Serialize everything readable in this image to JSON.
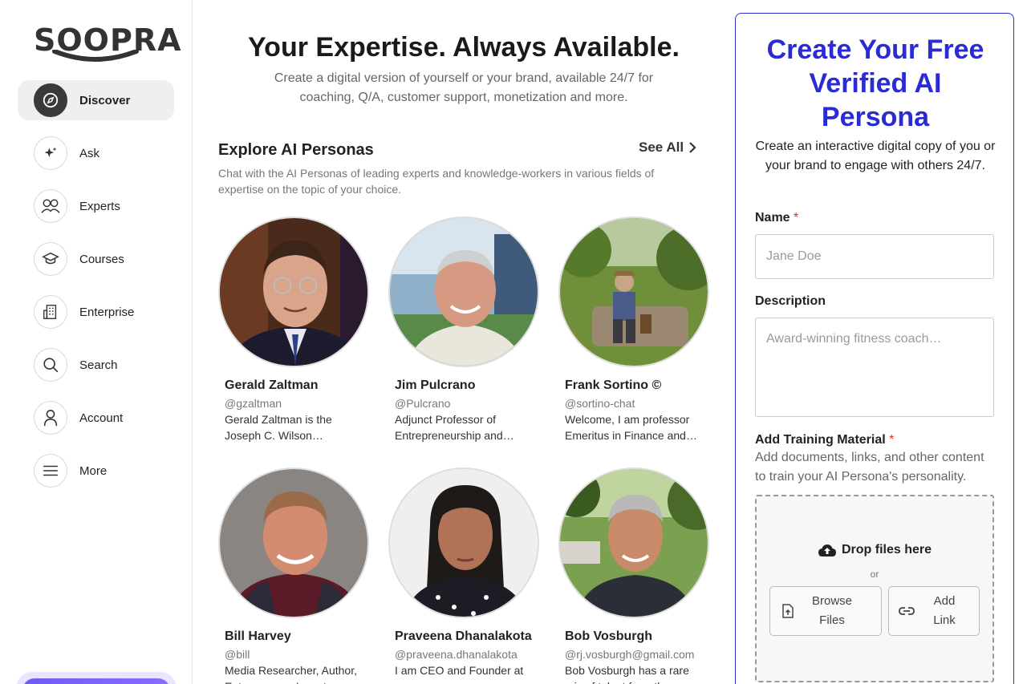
{
  "brand": {
    "name": "SOOPRA"
  },
  "sidebar": {
    "items": [
      {
        "label": "Discover",
        "icon": "compass-icon",
        "active": true
      },
      {
        "label": "Ask",
        "icon": "sparkle-icon"
      },
      {
        "label": "Experts",
        "icon": "people-icon"
      },
      {
        "label": "Courses",
        "icon": "graduation-cap-icon"
      },
      {
        "label": "Enterprise",
        "icon": "building-icon"
      },
      {
        "label": "Search",
        "icon": "search-icon"
      },
      {
        "label": "Account",
        "icon": "person-icon"
      },
      {
        "label": "More",
        "icon": "menu-icon"
      }
    ]
  },
  "hero": {
    "title": "Your Expertise. Always Available.",
    "subtitle": "Create a digital version of yourself or your brand, available 24/7 for coaching, Q/A, customer support, monetization and more."
  },
  "explore": {
    "title": "Explore AI Personas",
    "see_all": "See All",
    "description": "Chat with the AI Personas of leading experts and knowledge-workers in various fields of expertise on the topic of your choice.",
    "personas": [
      {
        "name": "Gerald Zaltman",
        "handle": "@gzaltman",
        "bio": "Gerald Zaltman is the Joseph C. Wilson…"
      },
      {
        "name": "Jim Pulcrano",
        "handle": "@Pulcrano",
        "bio": "Adjunct Professor of Entrepreneurship and…"
      },
      {
        "name": "Frank Sortino ©",
        "handle": "@sortino-chat",
        "bio": "Welcome, I am professor Emeritus in Finance and…"
      },
      {
        "name": "Bill Harvey",
        "handle": "@bill",
        "bio": "Media Researcher, Author, Entrepreneur, Inventor"
      },
      {
        "name": "Praveena Dhanalakota",
        "handle": "@praveena.dhanalakota",
        "bio": "I am CEO and Founder at"
      },
      {
        "name": "Bob Vosburgh",
        "handle": "@rj.vosburgh@gmail.com",
        "bio": "Bob Vosburgh has a rare mix of talent from the"
      }
    ]
  },
  "form": {
    "title": "Create Your Free Verified AI Persona",
    "subtitle": "Create an interactive digital copy of you or your brand to engage with others 24/7.",
    "name_label": "Name",
    "name_placeholder": "Jane Doe",
    "description_label": "Description",
    "description_placeholder": "Award-winning fitness coach…",
    "training_label": "Add Training Material",
    "training_help": "Add documents, links, and other content to train your AI Persona's personality.",
    "required_mark": "*",
    "drop_title": "Drop files here",
    "drop_or": "or",
    "browse_label": "Browse Files",
    "add_link_label": "Add Link"
  },
  "colors": {
    "accent": "#2b2bd4",
    "required": "#d93025",
    "cta": "#7b61ff"
  }
}
